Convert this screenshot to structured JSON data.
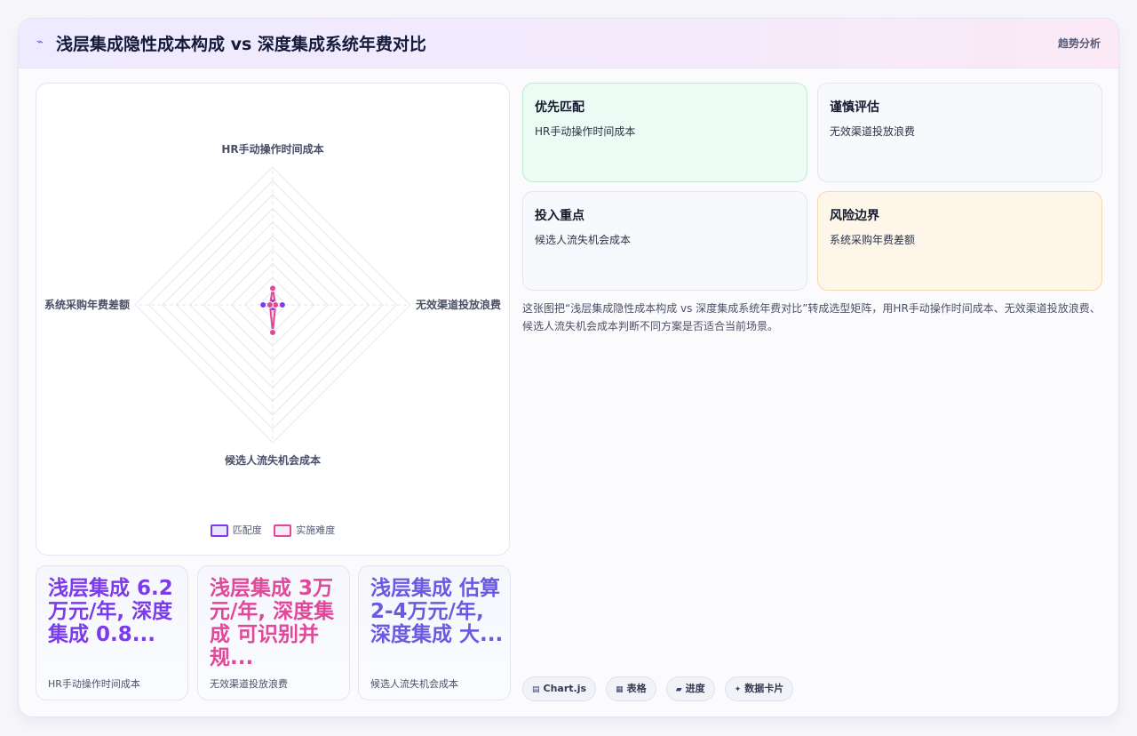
{
  "header": {
    "icon": "sparkline-icon",
    "title": "浅层集成隐性成本构成 vs 深度集成系统年费对比",
    "tag": "趋势分析"
  },
  "colors": {
    "accent_purple": "#7c3aed",
    "accent_pink": "#e0489a",
    "accent_indigo": "#6b5ae0",
    "green_bg": "#ecfbf3",
    "amber_bg": "#fff6ea"
  },
  "chart_data": {
    "type": "radar",
    "axes": [
      "HR手动操作时间成本",
      "无效渠道投放浪费",
      "候选人流失机会成本",
      "系统采购年费差额"
    ],
    "r_range": [
      0,
      10
    ],
    "grid_levels": 10,
    "series": [
      {
        "name": "匹配度",
        "color": "#7c3aed",
        "values": [
          0.2,
          0.7,
          0.2,
          0.7
        ]
      },
      {
        "name": "实施难度",
        "color": "#e0489a",
        "values": [
          1.2,
          0.2,
          2.0,
          0.2
        ]
      }
    ],
    "legend": "bottom"
  },
  "stats": [
    {
      "value": "浅层集成 6.2万元/年, 深度集成 0.8...",
      "label": "HR手动操作时间成本",
      "color": "#7c3aed"
    },
    {
      "value": "浅层集成 3万元/年, 深度集成 可识别并规...",
      "label": "无效渠道投放浪费",
      "color": "#e0489a"
    },
    {
      "value": "浅层集成 估算2-4万元/年, 深度集成 大...",
      "label": "候选人流失机会成本",
      "color": "#6b5ae0"
    }
  ],
  "quadrants": [
    {
      "title": "优先匹配",
      "body": "HR手动操作时间成本"
    },
    {
      "title": "谨慎评估",
      "body": "无效渠道投放浪费"
    },
    {
      "title": "投入重点",
      "body": "候选人流失机会成本"
    },
    {
      "title": "风险边界",
      "body": "系统采购年费差额"
    }
  ],
  "description": "这张图把“浅层集成隐性成本构成 vs 深度集成系统年费对比”转成选型矩阵，用HR手动操作时间成本、无效渠道投放浪费、候选人流失机会成本判断不同方案是否适合当前场景。",
  "chips": [
    {
      "icon": "chart-icon",
      "glyph": "▤",
      "label": "Chart.js"
    },
    {
      "icon": "table-icon",
      "glyph": "▦",
      "label": "表格"
    },
    {
      "icon": "progress-icon",
      "glyph": "▰",
      "label": "进度"
    },
    {
      "icon": "sparkle-icon",
      "glyph": "✦",
      "label": "数据卡片"
    }
  ]
}
